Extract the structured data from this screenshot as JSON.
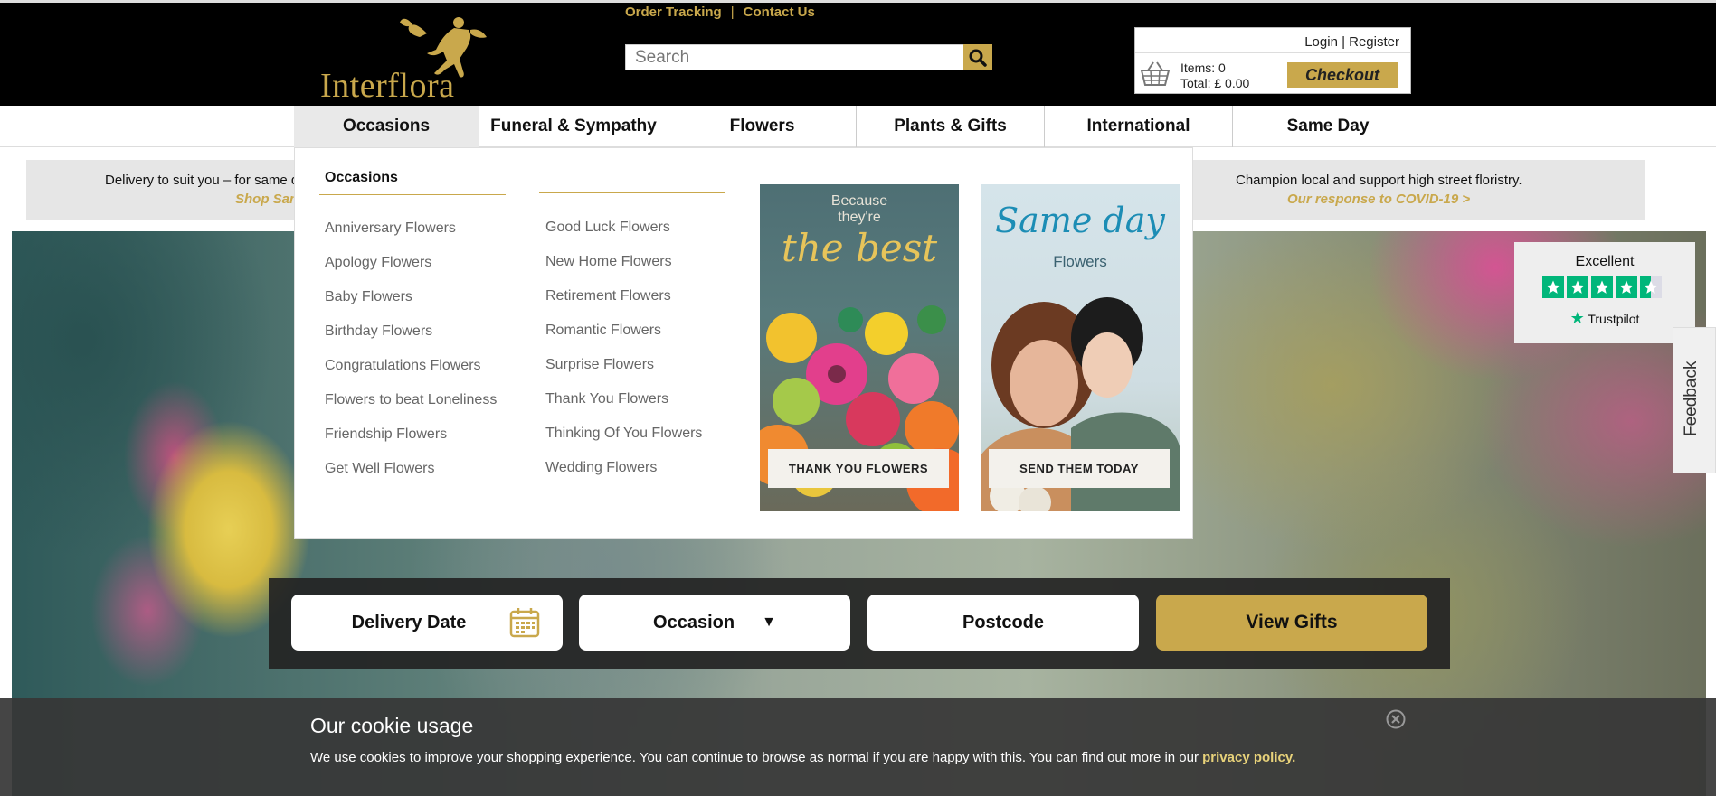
{
  "header": {
    "logo_text": "Interflora",
    "top_links": [
      "Order Tracking",
      "Contact Us"
    ],
    "search_placeholder": "Search",
    "login_text": "Login | Register",
    "items_text": "Items: 0",
    "total_text": "Total: £ 0.00",
    "checkout_label": "Checkout"
  },
  "nav": {
    "tabs": [
      "Occasions",
      "Funeral & Sympathy",
      "Flowers",
      "Plants & Gifts",
      "International",
      "Same Day"
    ],
    "active": "Occasions"
  },
  "promo": {
    "left_text": "Delivery to suit you – for same d",
    "left_link": "Shop Sam",
    "right_text": "Champion local and support high street floristry.",
    "right_link": "Our response to COVID-19 >"
  },
  "mega_menu": {
    "heading": "Occasions",
    "col1": [
      "Anniversary Flowers",
      "Apology Flowers",
      "Baby Flowers",
      "Birthday Flowers",
      "Congratulations Flowers",
      "Flowers to beat Loneliness",
      "Friendship Flowers",
      "Get Well Flowers"
    ],
    "col2": [
      "Good Luck Flowers",
      "New Home Flowers",
      "Retirement Flowers",
      "Romantic Flowers",
      "Surprise Flowers",
      "Thank You Flowers",
      "Thinking Of You Flowers",
      "Wedding Flowers"
    ],
    "card1": {
      "line1": "Because",
      "line2": "they're",
      "line3": "the best",
      "button": "THANK YOU FLOWERS"
    },
    "card2": {
      "line1": "Same day",
      "line2": "Flowers",
      "button": "SEND THEM TODAY"
    }
  },
  "trustpilot": {
    "rating_text": "Excellent",
    "brand": "Trustpilot",
    "stars": 4.5
  },
  "feedback_label": "Feedback",
  "finder": {
    "delivery_date": "Delivery Date",
    "occasion": "Occasion",
    "postcode": "Postcode",
    "submit": "View Gifts"
  },
  "cookie": {
    "title": "Our cookie usage",
    "text": "We use cookies to improve your shopping experience. You can continue to browse as normal if you are happy with this. You can find out more in our ",
    "link": "privacy policy."
  },
  "colors": {
    "gold": "#c9a84c",
    "black": "#000000",
    "trustpilot_green": "#00b67a"
  }
}
